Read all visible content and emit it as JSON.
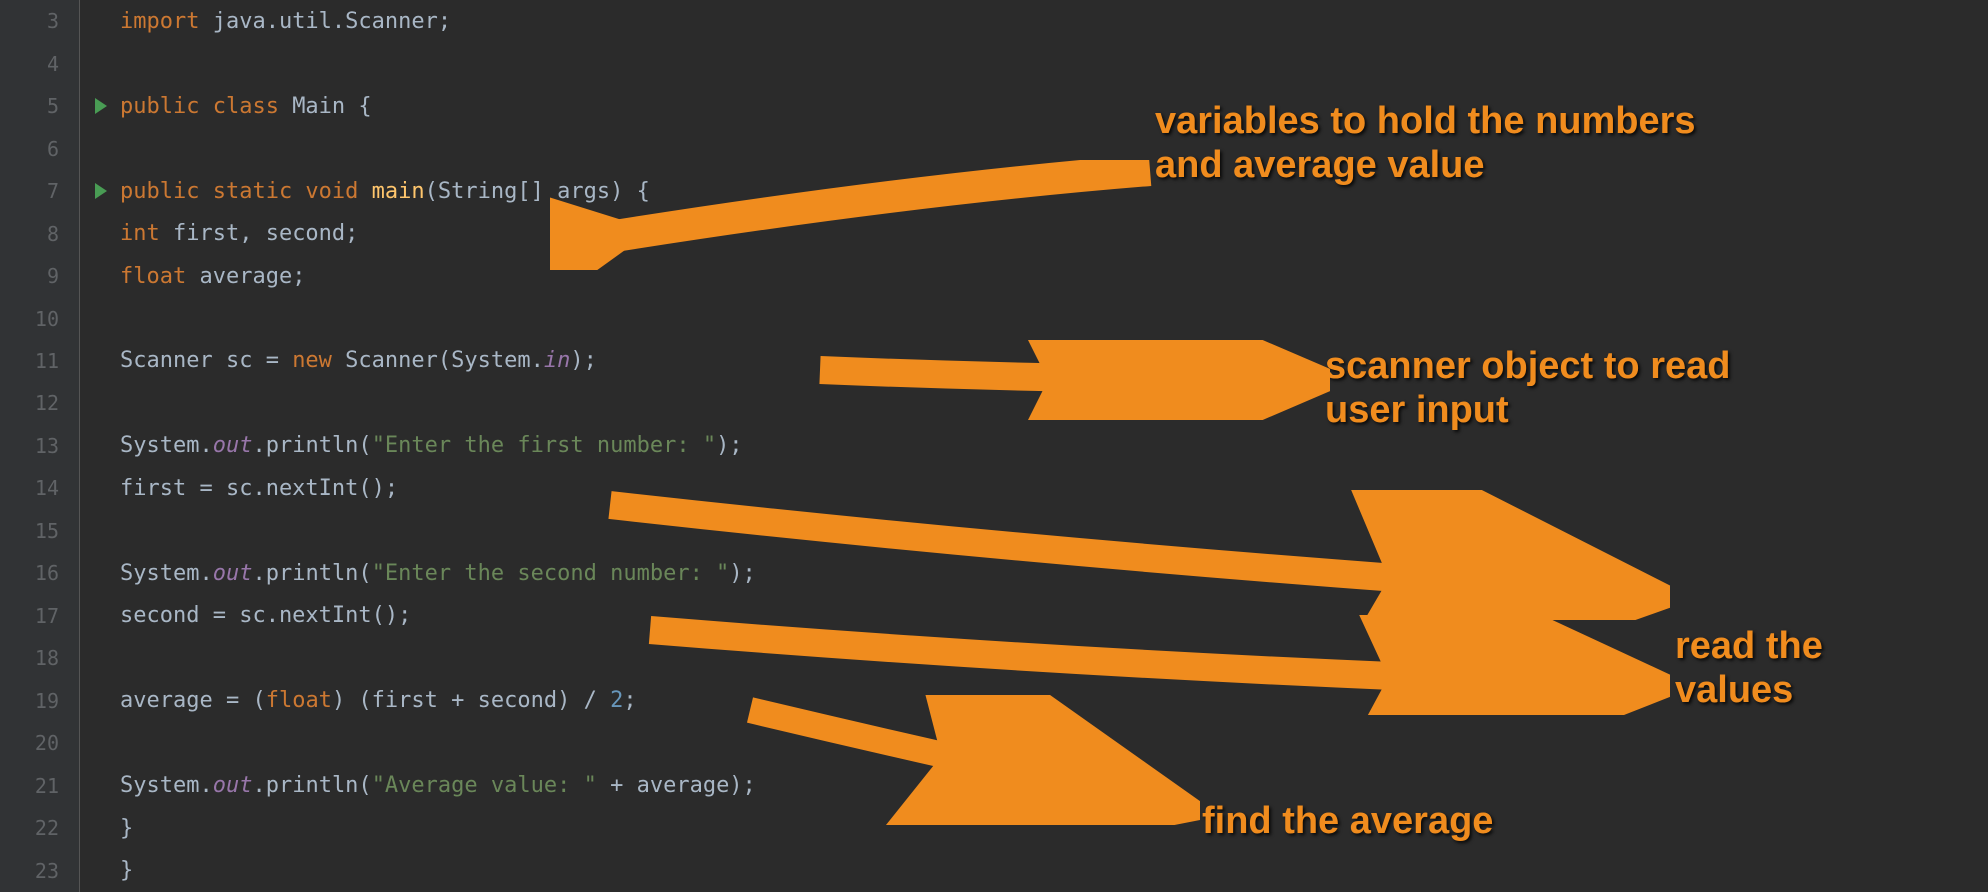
{
  "gutter": {
    "lines": [
      "3",
      "4",
      "5",
      "6",
      "7",
      "8",
      "9",
      "10",
      "11",
      "12",
      "13",
      "14",
      "15",
      "16",
      "17",
      "18",
      "19",
      "20",
      "21",
      "22",
      "23"
    ],
    "run_markers": [
      5,
      7
    ],
    "fold_markers": [
      7,
      22
    ]
  },
  "code": {
    "l3": {
      "kw1": "import ",
      "p1": "java.util.Scanner;"
    },
    "l5": {
      "kw1": "public class ",
      "name": "Main ",
      "brace": "{"
    },
    "l7": {
      "kw1": "public static void ",
      "method": "main",
      "args": "(String[] args) {"
    },
    "l8": {
      "kw1": "int ",
      "vars": "first, second;"
    },
    "l9": {
      "kw1": "float ",
      "vars": "average;"
    },
    "l11": {
      "p1": "Scanner sc = ",
      "kw1": "new ",
      "p2": "Scanner(System.",
      "sf": "in",
      "p3": ");"
    },
    "l13": {
      "p1": "System.",
      "sf": "out",
      "p2": ".println(",
      "str": "\"Enter the first number: \"",
      "p3": ");"
    },
    "l14": {
      "p1": "first = sc.nextInt();"
    },
    "l16": {
      "p1": "System.",
      "sf": "out",
      "p2": ".println(",
      "str": "\"Enter the second number: \"",
      "p3": ");"
    },
    "l17": {
      "p1": "second = sc.nextInt();"
    },
    "l19": {
      "p1": "average = (",
      "kw1": "float",
      "p2": ") (first + second) / ",
      "num": "2",
      "p3": ";"
    },
    "l21": {
      "p1": "System.",
      "sf": "out",
      "p2": ".println(",
      "str": "\"Average value: \"",
      "p3": " + average);"
    },
    "l22": {
      "brace": "}"
    },
    "l23": {
      "brace": "}"
    }
  },
  "annotations": {
    "a1_line1": "variables to hold the numbers",
    "a1_line2": "and average value",
    "a2_line1": "scanner object to read",
    "a2_line2": "user input",
    "a3_line1": "read the",
    "a3_line2": "values",
    "a4": "find the average"
  }
}
